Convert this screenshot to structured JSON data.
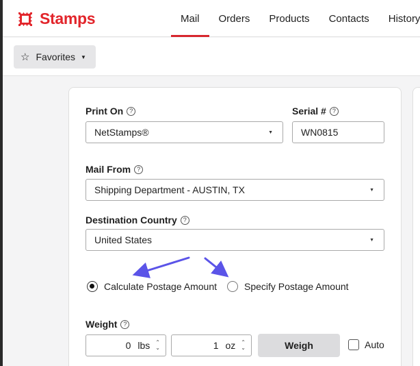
{
  "brand": {
    "name": "Stamps",
    "color": "#e2252b"
  },
  "nav": {
    "tabs": [
      {
        "label": "Mail",
        "active": true
      },
      {
        "label": "Orders"
      },
      {
        "label": "Products"
      },
      {
        "label": "Contacts"
      },
      {
        "label": "History"
      }
    ]
  },
  "favorites": {
    "label": "Favorites"
  },
  "form": {
    "print_on": {
      "label": "Print On",
      "value": "NetStamps®"
    },
    "serial": {
      "label": "Serial #",
      "value": "WN0815"
    },
    "mail_from": {
      "label": "Mail From",
      "value": "Shipping Department - AUSTIN, TX"
    },
    "destination": {
      "label": "Destination Country",
      "value": "United States"
    },
    "postage": {
      "calculate": "Calculate Postage Amount",
      "specify": "Specify Postage Amount",
      "selected": "calculate"
    },
    "weight": {
      "label": "Weight",
      "lbs_value": "0",
      "lbs_unit": "lbs",
      "oz_value": "1",
      "oz_unit": "oz",
      "weigh_label": "Weigh",
      "auto_label": "Auto"
    }
  },
  "icons": {
    "help": "help-circle-icon",
    "star": "star-icon",
    "caret": "caret-down-icon"
  },
  "colors": {
    "accent": "#d7262d",
    "arrow": "#5b54e8"
  }
}
